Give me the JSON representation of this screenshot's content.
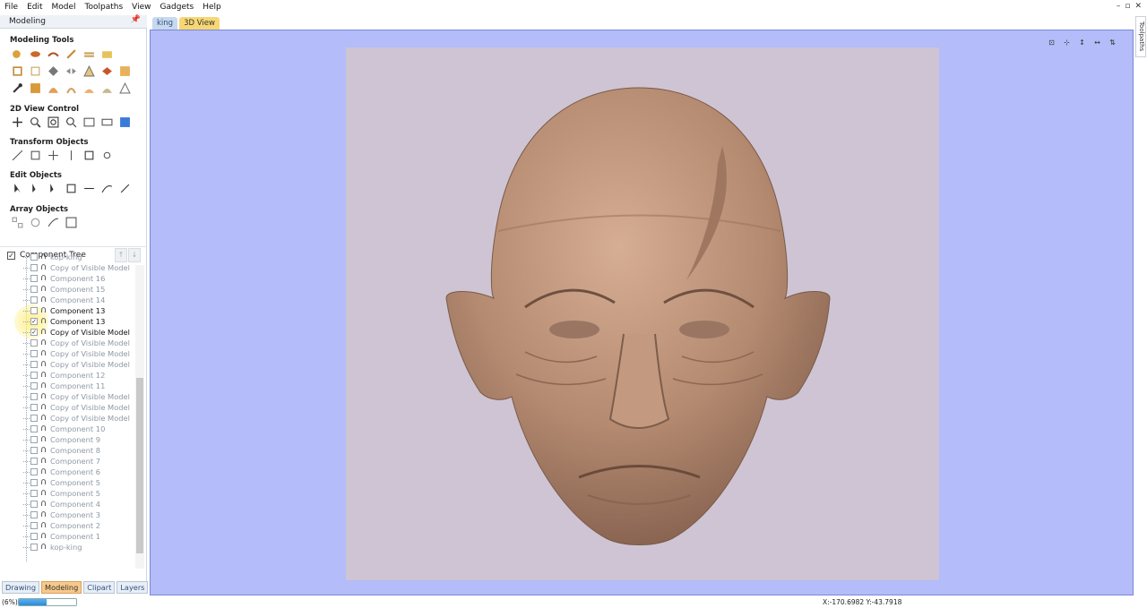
{
  "menu": [
    "File",
    "Edit",
    "Model",
    "Toolpaths",
    "View",
    "Gadgets",
    "Help"
  ],
  "left_panel": {
    "title": "Modeling",
    "sections": {
      "modeling_tools": "Modeling Tools",
      "view_control": "2D View Control",
      "transform": "Transform Objects",
      "edit": "Edit Objects",
      "array": "Array Objects"
    },
    "component_tree_title": "Component Tree",
    "tree": [
      {
        "label": "kop-king",
        "checked": false,
        "active": false
      },
      {
        "label": "Copy of Visible Model",
        "checked": false,
        "active": false
      },
      {
        "label": "Component 16",
        "checked": false,
        "active": false
      },
      {
        "label": "Component 15",
        "checked": false,
        "active": false
      },
      {
        "label": "Component 14",
        "checked": false,
        "active": false
      },
      {
        "label": "Component 13",
        "checked": false,
        "active": true
      },
      {
        "label": "Component 13",
        "checked": true,
        "active": true
      },
      {
        "label": "Copy of Visible Model",
        "checked": true,
        "active": true
      },
      {
        "label": "Copy of Visible Model",
        "checked": false,
        "active": false
      },
      {
        "label": "Copy of Visible Model",
        "checked": false,
        "active": false
      },
      {
        "label": "Copy of Visible Model",
        "checked": false,
        "active": false
      },
      {
        "label": "Component 12",
        "checked": false,
        "active": false
      },
      {
        "label": "Component 11",
        "checked": false,
        "active": false
      },
      {
        "label": "Copy of Visible Model",
        "checked": false,
        "active": false
      },
      {
        "label": "Copy of Visible Model",
        "checked": false,
        "active": false
      },
      {
        "label": "Copy of Visible Model",
        "checked": false,
        "active": false
      },
      {
        "label": "Component 10",
        "checked": false,
        "active": false
      },
      {
        "label": "Component 9",
        "checked": false,
        "active": false
      },
      {
        "label": "Component 8",
        "checked": false,
        "active": false
      },
      {
        "label": "Component 7",
        "checked": false,
        "active": false
      },
      {
        "label": "Component 6",
        "checked": false,
        "active": false
      },
      {
        "label": "Component 5",
        "checked": false,
        "active": false
      },
      {
        "label": "Component 5",
        "checked": false,
        "active": false
      },
      {
        "label": "Component 4",
        "checked": false,
        "active": false
      },
      {
        "label": "Component 3",
        "checked": false,
        "active": false
      },
      {
        "label": "Component 2",
        "checked": false,
        "active": false
      },
      {
        "label": "Component 1",
        "checked": false,
        "active": false
      },
      {
        "label": "kop-king",
        "checked": false,
        "active": false
      }
    ],
    "bottom_tabs": [
      "Drawing",
      "Modeling",
      "Clipart",
      "Layers"
    ],
    "active_bottom_tab": "Modeling"
  },
  "doc_tabs": [
    "king",
    "3D View"
  ],
  "active_doc_tab": "3D View",
  "side_tab": "Toolpaths",
  "status": {
    "progress_text": "(6%)",
    "progress_fraction": 0.06,
    "coords": "X:-170.6982 Y:-43.7918"
  },
  "colors": {
    "view_background": "#b4bcf9",
    "stock_color": "#cec4d3",
    "model_color": "#b48a70",
    "active_tab": "#f7c98a"
  }
}
